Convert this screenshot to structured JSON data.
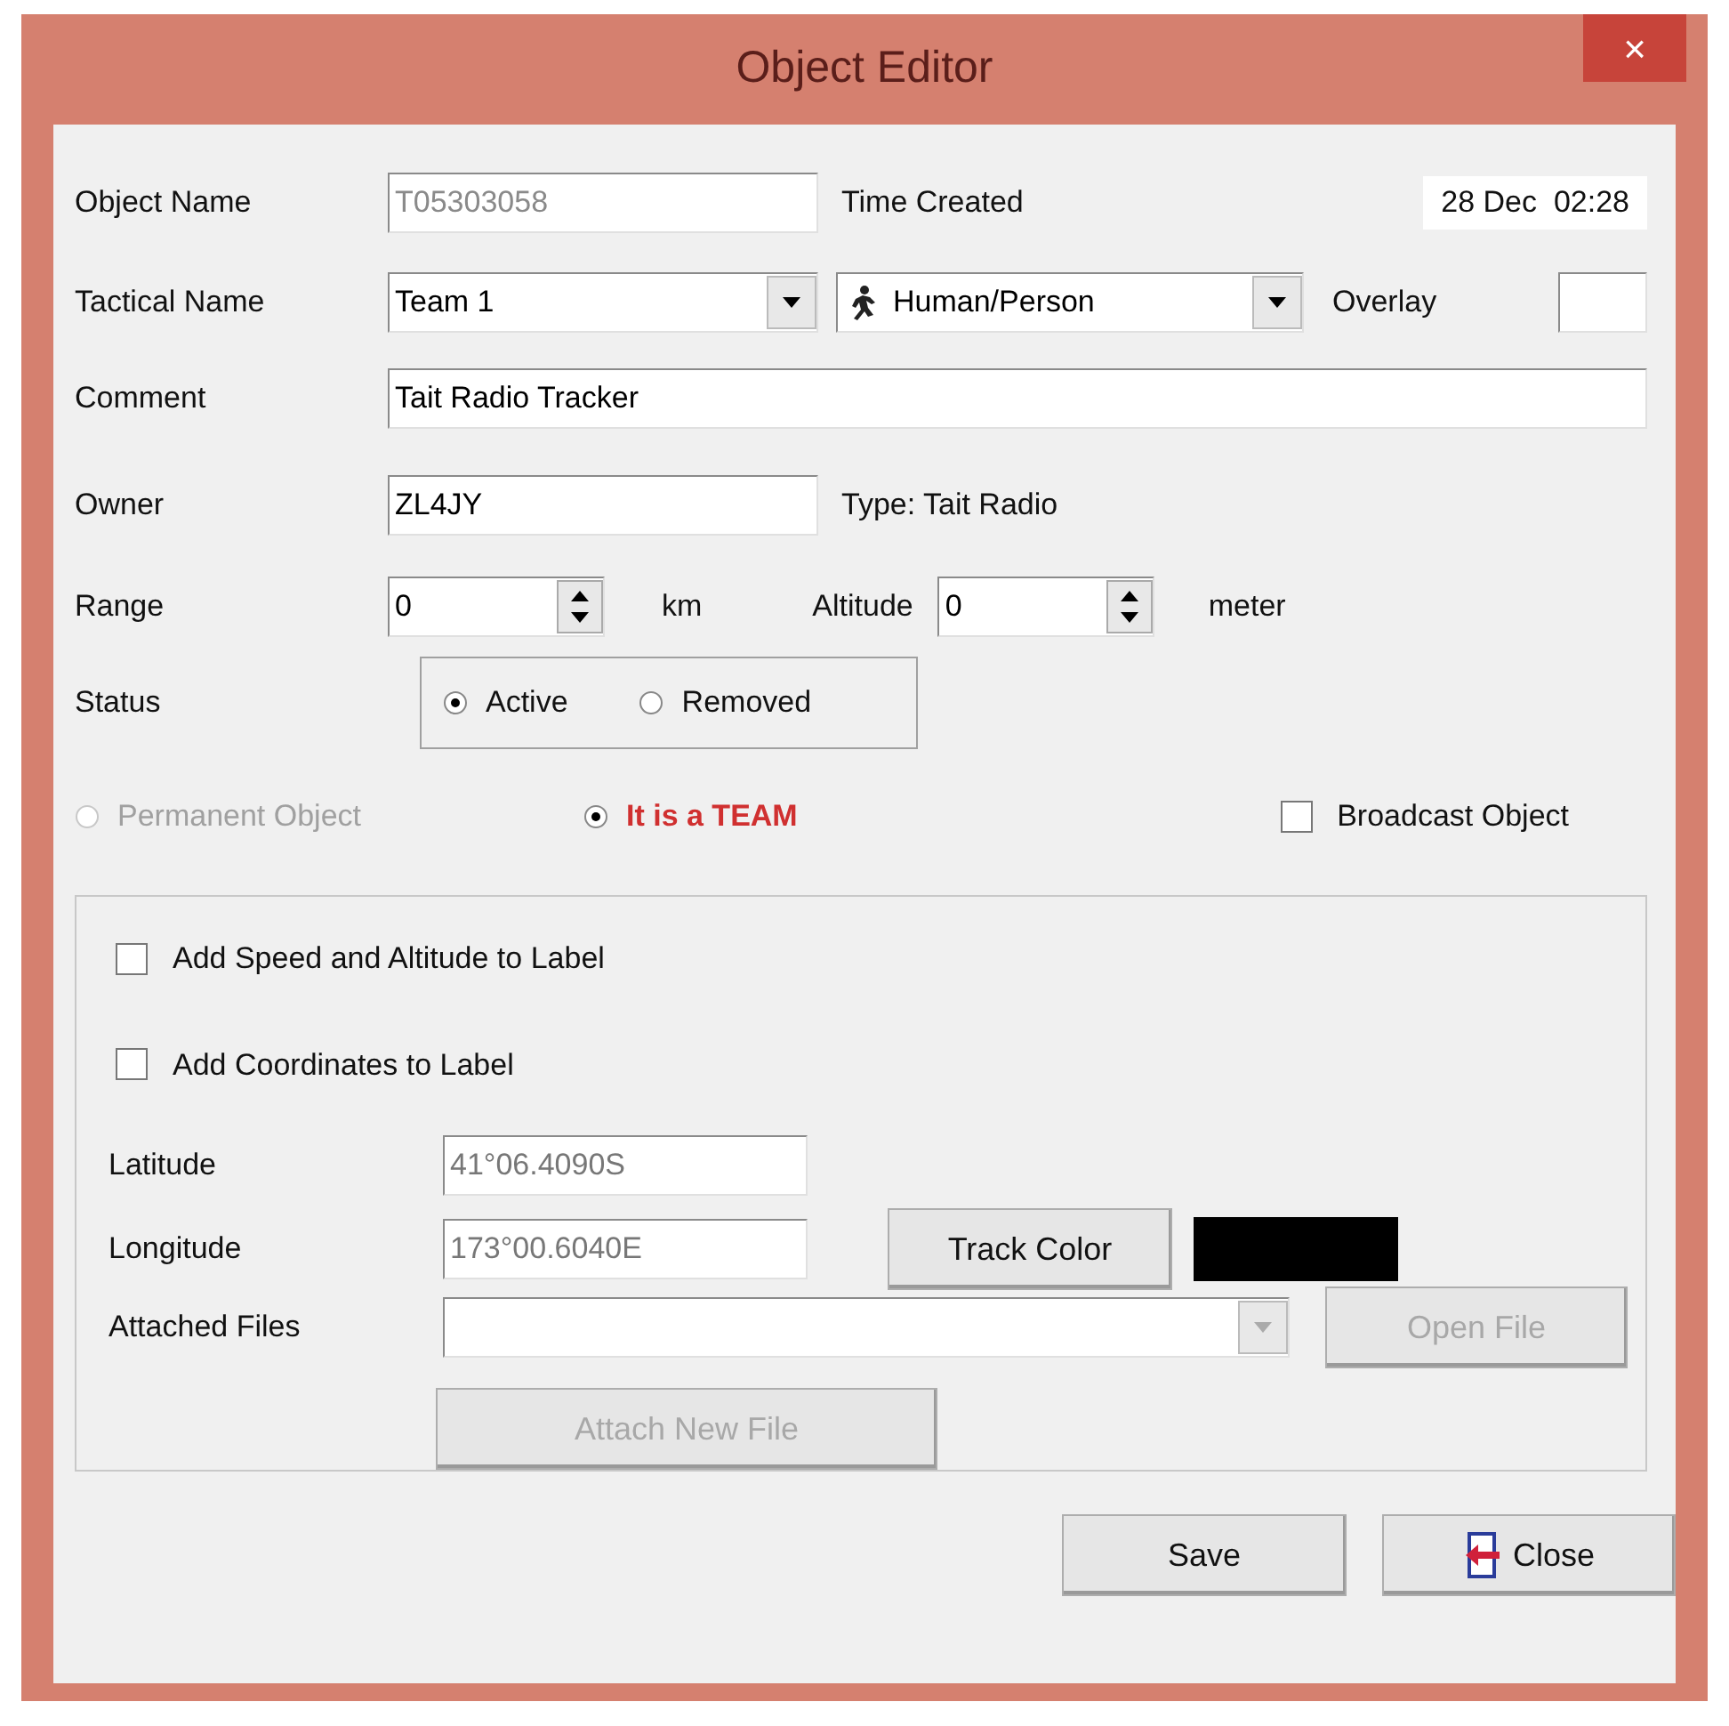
{
  "window": {
    "title": "Object Editor",
    "close": "×"
  },
  "object_name": {
    "label": "Object Name",
    "value": "T05303058",
    "disabled": true
  },
  "time_created": {
    "label": "Time Created",
    "value": "28 Dec  02:28"
  },
  "tactical_name": {
    "label": "Tactical Name",
    "value": "Team 1"
  },
  "symbol": {
    "value": "Human/Person"
  },
  "overlay": {
    "label": "Overlay"
  },
  "comment": {
    "label": "Comment",
    "value": "Tait Radio Tracker"
  },
  "owner": {
    "label": "Owner",
    "value": "ZL4JY"
  },
  "type_text": "Type: Tait Radio",
  "range": {
    "label": "Range",
    "value": "0",
    "unit": "km"
  },
  "altitude": {
    "label": "Altitude",
    "value": "0",
    "unit": "meter"
  },
  "status": {
    "label": "Status",
    "options": [
      {
        "label": "Active",
        "selected": true
      },
      {
        "label": "Removed",
        "selected": false
      }
    ]
  },
  "object_kind": [
    {
      "label": "Permanent Object",
      "selected": false,
      "disabled": true
    },
    {
      "label": "It is a TEAM",
      "selected": true,
      "disabled": false
    }
  ],
  "broadcast": {
    "label": "Broadcast Object",
    "checked": false
  },
  "label_options": [
    {
      "label": "Add Speed and Altitude to Label",
      "checked": false
    },
    {
      "label": "Add Coordinates to Label",
      "checked": false
    }
  ],
  "latitude": {
    "label": "Latitude",
    "value": "41°06.4090S",
    "disabled": true
  },
  "longitude": {
    "label": "Longitude",
    "value": "173°00.6040E",
    "disabled": true
  },
  "track_color": {
    "label": "Track Color",
    "color": "#000000"
  },
  "attached_files": {
    "label": "Attached Files"
  },
  "open_file": {
    "label": "Open File",
    "disabled": true
  },
  "attach_new_file": {
    "label": "Attach New File",
    "disabled": true
  },
  "save": {
    "label": "Save"
  },
  "close_button": {
    "label": "Close"
  }
}
